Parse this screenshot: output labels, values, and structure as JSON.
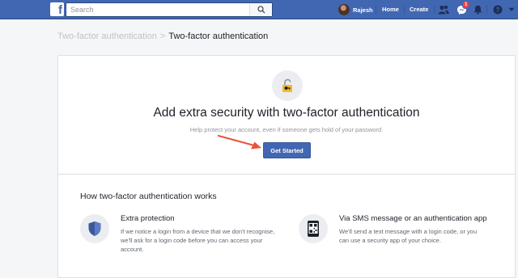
{
  "topbar": {
    "logo_letter": "f",
    "search_placeholder": "Search",
    "user_name": "Rajesh",
    "nav": [
      "Home",
      "Create"
    ],
    "message_badge": "1",
    "brand_color": "#4267b2"
  },
  "breadcrumb": {
    "parent": "Two-factor authentication",
    "separator": ">",
    "current": "Two-factor authentication"
  },
  "hero": {
    "icon": "lock-icon",
    "title": "Add extra security with two-factor authentication",
    "subtitle": "Help protect your account, even if someone gets hold of your password.",
    "button_label": "Get Started"
  },
  "how": {
    "title": "How two-factor authentication works",
    "features": [
      {
        "icon": "shield-icon",
        "title": "Extra protection",
        "lines": [
          "If we notice a login from a device that we don't recognise,",
          "we'll ask for a login code before you can access your",
          "account."
        ]
      },
      {
        "icon": "phone-qr-icon",
        "title": "Via SMS message or an authentication app",
        "lines": [
          "We'll send a text message with a login code, or you",
          "can use a security app of your choice."
        ]
      }
    ]
  }
}
